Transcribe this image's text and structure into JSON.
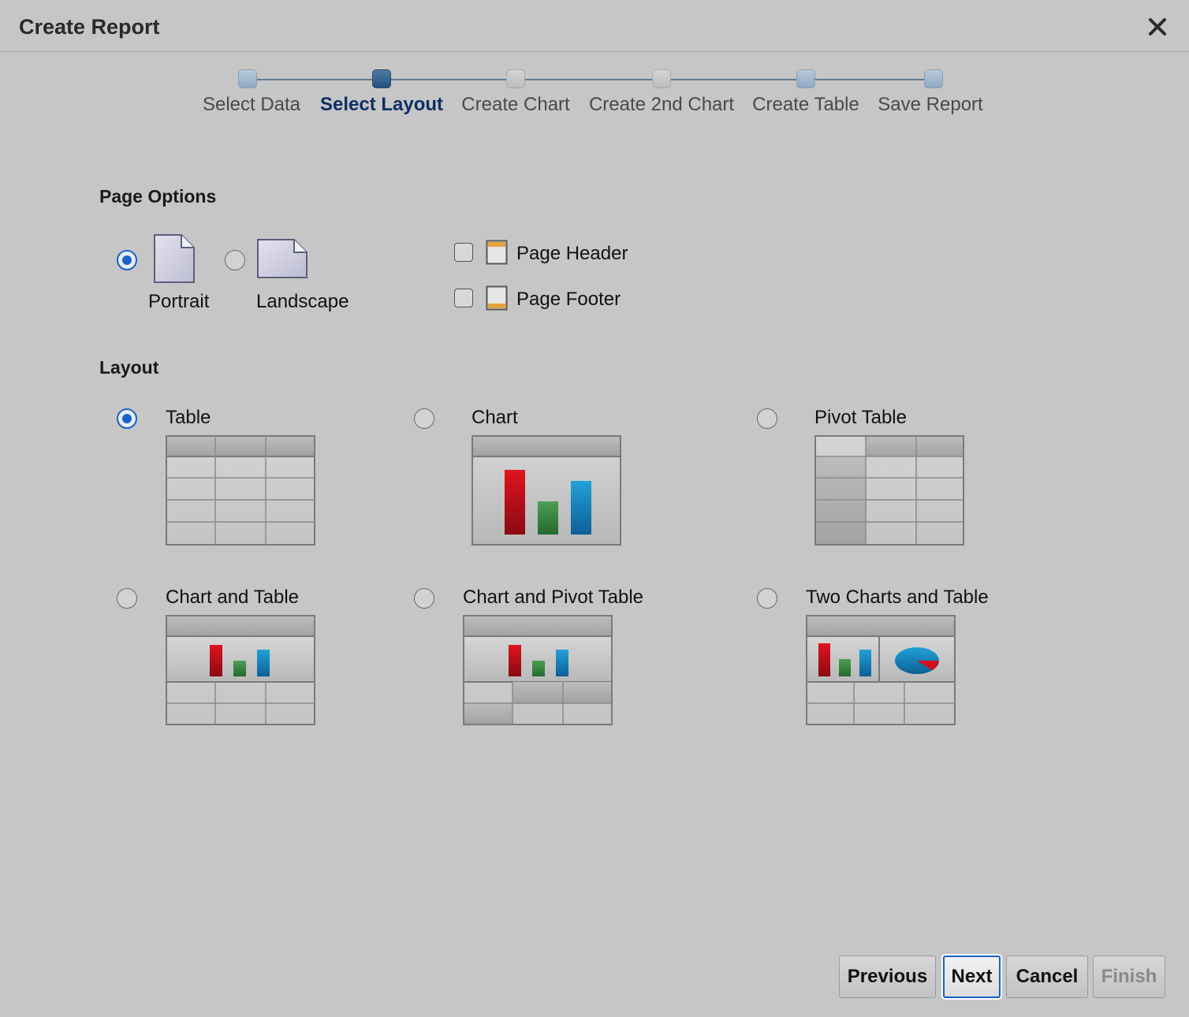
{
  "dialog": {
    "title": "Create Report"
  },
  "train": {
    "steps": [
      {
        "label": "Select Data",
        "state": "visited"
      },
      {
        "label": "Select Layout",
        "state": "current"
      },
      {
        "label": "Create Chart",
        "state": "disabled"
      },
      {
        "label": "Create 2nd Chart",
        "state": "disabled"
      },
      {
        "label": "Create Table",
        "state": "visited"
      },
      {
        "label": "Save Report",
        "state": "visited"
      }
    ]
  },
  "page_options": {
    "heading": "Page Options",
    "orientation": [
      {
        "label": "Portrait",
        "checked": true
      },
      {
        "label": "Landscape",
        "checked": false
      }
    ],
    "header_label": "Page Header",
    "header_checked": false,
    "footer_label": "Page Footer",
    "footer_checked": false
  },
  "layout": {
    "heading": "Layout",
    "options": [
      {
        "label": "Table",
        "checked": true
      },
      {
        "label": "Chart",
        "checked": false
      },
      {
        "label": "Pivot Table",
        "checked": false
      },
      {
        "label": "Chart and Table",
        "checked": false
      },
      {
        "label": "Chart and Pivot Table",
        "checked": false
      },
      {
        "label": "Two Charts and Table",
        "checked": false
      }
    ]
  },
  "buttons": {
    "previous": "Previous",
    "next": "Next",
    "cancel": "Cancel",
    "finish": "Finish"
  },
  "colors": {
    "accent": "#1a62c8",
    "current_step": "#0e2f63",
    "bar_red": "#c40f1e",
    "bar_green": "#3e8a44",
    "bar_blue": "#1a86c2"
  }
}
